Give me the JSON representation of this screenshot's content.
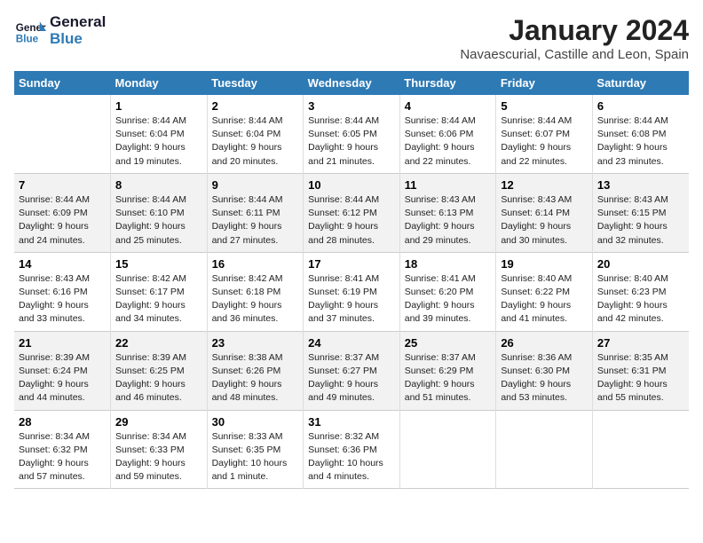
{
  "logo": {
    "line1": "General",
    "line2": "Blue"
  },
  "title": "January 2024",
  "subtitle": "Navaescurial, Castille and Leon, Spain",
  "days_of_week": [
    "Sunday",
    "Monday",
    "Tuesday",
    "Wednesday",
    "Thursday",
    "Friday",
    "Saturday"
  ],
  "weeks": [
    [
      {
        "day": "",
        "sunrise": "",
        "sunset": "",
        "daylight": ""
      },
      {
        "day": "1",
        "sunrise": "Sunrise: 8:44 AM",
        "sunset": "Sunset: 6:04 PM",
        "daylight": "Daylight: 9 hours and 19 minutes."
      },
      {
        "day": "2",
        "sunrise": "Sunrise: 8:44 AM",
        "sunset": "Sunset: 6:04 PM",
        "daylight": "Daylight: 9 hours and 20 minutes."
      },
      {
        "day": "3",
        "sunrise": "Sunrise: 8:44 AM",
        "sunset": "Sunset: 6:05 PM",
        "daylight": "Daylight: 9 hours and 21 minutes."
      },
      {
        "day": "4",
        "sunrise": "Sunrise: 8:44 AM",
        "sunset": "Sunset: 6:06 PM",
        "daylight": "Daylight: 9 hours and 22 minutes."
      },
      {
        "day": "5",
        "sunrise": "Sunrise: 8:44 AM",
        "sunset": "Sunset: 6:07 PM",
        "daylight": "Daylight: 9 hours and 22 minutes."
      },
      {
        "day": "6",
        "sunrise": "Sunrise: 8:44 AM",
        "sunset": "Sunset: 6:08 PM",
        "daylight": "Daylight: 9 hours and 23 minutes."
      }
    ],
    [
      {
        "day": "7",
        "sunrise": "Sunrise: 8:44 AM",
        "sunset": "Sunset: 6:09 PM",
        "daylight": "Daylight: 9 hours and 24 minutes."
      },
      {
        "day": "8",
        "sunrise": "Sunrise: 8:44 AM",
        "sunset": "Sunset: 6:10 PM",
        "daylight": "Daylight: 9 hours and 25 minutes."
      },
      {
        "day": "9",
        "sunrise": "Sunrise: 8:44 AM",
        "sunset": "Sunset: 6:11 PM",
        "daylight": "Daylight: 9 hours and 27 minutes."
      },
      {
        "day": "10",
        "sunrise": "Sunrise: 8:44 AM",
        "sunset": "Sunset: 6:12 PM",
        "daylight": "Daylight: 9 hours and 28 minutes."
      },
      {
        "day": "11",
        "sunrise": "Sunrise: 8:43 AM",
        "sunset": "Sunset: 6:13 PM",
        "daylight": "Daylight: 9 hours and 29 minutes."
      },
      {
        "day": "12",
        "sunrise": "Sunrise: 8:43 AM",
        "sunset": "Sunset: 6:14 PM",
        "daylight": "Daylight: 9 hours and 30 minutes."
      },
      {
        "day": "13",
        "sunrise": "Sunrise: 8:43 AM",
        "sunset": "Sunset: 6:15 PM",
        "daylight": "Daylight: 9 hours and 32 minutes."
      }
    ],
    [
      {
        "day": "14",
        "sunrise": "Sunrise: 8:43 AM",
        "sunset": "Sunset: 6:16 PM",
        "daylight": "Daylight: 9 hours and 33 minutes."
      },
      {
        "day": "15",
        "sunrise": "Sunrise: 8:42 AM",
        "sunset": "Sunset: 6:17 PM",
        "daylight": "Daylight: 9 hours and 34 minutes."
      },
      {
        "day": "16",
        "sunrise": "Sunrise: 8:42 AM",
        "sunset": "Sunset: 6:18 PM",
        "daylight": "Daylight: 9 hours and 36 minutes."
      },
      {
        "day": "17",
        "sunrise": "Sunrise: 8:41 AM",
        "sunset": "Sunset: 6:19 PM",
        "daylight": "Daylight: 9 hours and 37 minutes."
      },
      {
        "day": "18",
        "sunrise": "Sunrise: 8:41 AM",
        "sunset": "Sunset: 6:20 PM",
        "daylight": "Daylight: 9 hours and 39 minutes."
      },
      {
        "day": "19",
        "sunrise": "Sunrise: 8:40 AM",
        "sunset": "Sunset: 6:22 PM",
        "daylight": "Daylight: 9 hours and 41 minutes."
      },
      {
        "day": "20",
        "sunrise": "Sunrise: 8:40 AM",
        "sunset": "Sunset: 6:23 PM",
        "daylight": "Daylight: 9 hours and 42 minutes."
      }
    ],
    [
      {
        "day": "21",
        "sunrise": "Sunrise: 8:39 AM",
        "sunset": "Sunset: 6:24 PM",
        "daylight": "Daylight: 9 hours and 44 minutes."
      },
      {
        "day": "22",
        "sunrise": "Sunrise: 8:39 AM",
        "sunset": "Sunset: 6:25 PM",
        "daylight": "Daylight: 9 hours and 46 minutes."
      },
      {
        "day": "23",
        "sunrise": "Sunrise: 8:38 AM",
        "sunset": "Sunset: 6:26 PM",
        "daylight": "Daylight: 9 hours and 48 minutes."
      },
      {
        "day": "24",
        "sunrise": "Sunrise: 8:37 AM",
        "sunset": "Sunset: 6:27 PM",
        "daylight": "Daylight: 9 hours and 49 minutes."
      },
      {
        "day": "25",
        "sunrise": "Sunrise: 8:37 AM",
        "sunset": "Sunset: 6:29 PM",
        "daylight": "Daylight: 9 hours and 51 minutes."
      },
      {
        "day": "26",
        "sunrise": "Sunrise: 8:36 AM",
        "sunset": "Sunset: 6:30 PM",
        "daylight": "Daylight: 9 hours and 53 minutes."
      },
      {
        "day": "27",
        "sunrise": "Sunrise: 8:35 AM",
        "sunset": "Sunset: 6:31 PM",
        "daylight": "Daylight: 9 hours and 55 minutes."
      }
    ],
    [
      {
        "day": "28",
        "sunrise": "Sunrise: 8:34 AM",
        "sunset": "Sunset: 6:32 PM",
        "daylight": "Daylight: 9 hours and 57 minutes."
      },
      {
        "day": "29",
        "sunrise": "Sunrise: 8:34 AM",
        "sunset": "Sunset: 6:33 PM",
        "daylight": "Daylight: 9 hours and 59 minutes."
      },
      {
        "day": "30",
        "sunrise": "Sunrise: 8:33 AM",
        "sunset": "Sunset: 6:35 PM",
        "daylight": "Daylight: 10 hours and 1 minute."
      },
      {
        "day": "31",
        "sunrise": "Sunrise: 8:32 AM",
        "sunset": "Sunset: 6:36 PM",
        "daylight": "Daylight: 10 hours and 4 minutes."
      },
      {
        "day": "",
        "sunrise": "",
        "sunset": "",
        "daylight": ""
      },
      {
        "day": "",
        "sunrise": "",
        "sunset": "",
        "daylight": ""
      },
      {
        "day": "",
        "sunrise": "",
        "sunset": "",
        "daylight": ""
      }
    ]
  ]
}
